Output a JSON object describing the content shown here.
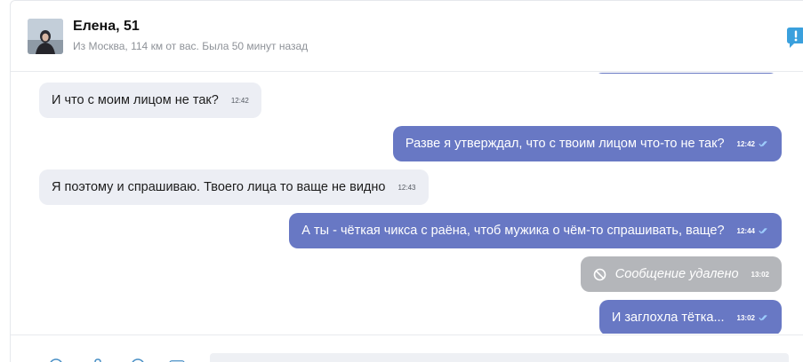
{
  "header": {
    "name": "Елена, 51",
    "status": "Из Москва, 114 км от вас. Была 50 минут назад"
  },
  "messages": [
    {
      "direction": "incoming",
      "text": "И что с моим лицом не так?",
      "time": "12:42"
    },
    {
      "direction": "outgoing",
      "text": "Разве я утверждал, что с твоим лицом что-то не так?",
      "time": "12:42",
      "read": true
    },
    {
      "direction": "incoming",
      "text": "Я поэтому и спрашиваю. Твоего лица то ваще не видно",
      "time": "12:43"
    },
    {
      "direction": "outgoing",
      "text": "А ты - чёткая чикса с раёна, чтоб мужика о чём-то спрашивать, ваще?",
      "time": "12:44",
      "read": true
    },
    {
      "direction": "outgoing",
      "deleted": true,
      "text": "Сообщение удалено",
      "time": "13:02"
    },
    {
      "direction": "outgoing",
      "text": "И заглохла тётка...",
      "time": "13:02",
      "read": true
    }
  ],
  "icons": {
    "report": "report-icon",
    "deleted": "ban-icon",
    "read": "double-check-icon",
    "composer": [
      "smile-icon",
      "attach-icon",
      "gift-icon",
      "photo-icon"
    ]
  },
  "colors": {
    "outgoing_bubble": "#6878c4",
    "incoming_bubble": "#eceef4",
    "deleted_bubble": "#b4b6ba",
    "report_icon": "#3aa0dd",
    "read_check": "#9fd0ff"
  }
}
